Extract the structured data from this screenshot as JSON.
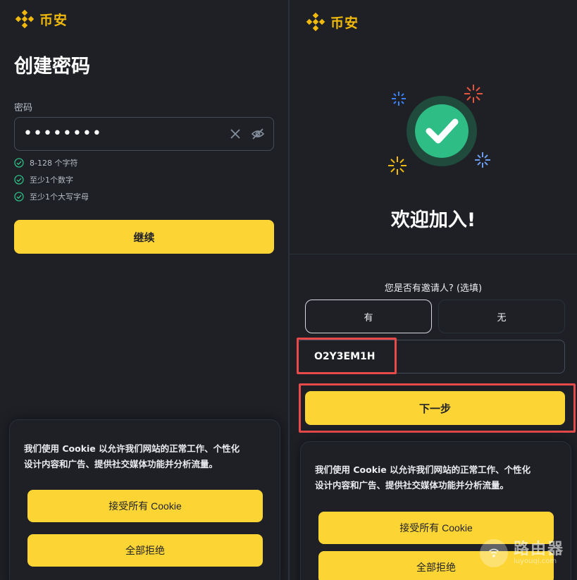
{
  "brand": {
    "name": "币安",
    "color": "#f0b90b"
  },
  "left": {
    "title": "创建密码",
    "password": {
      "label": "密码",
      "masked_value": "••••••••",
      "clear_icon": "close-icon",
      "visibility_icon": "eye-off-icon"
    },
    "rules": [
      {
        "text": "8-128 个字符",
        "status": "met"
      },
      {
        "text": "至少1个数字",
        "status": "met"
      },
      {
        "text": "至少1个大写字母",
        "status": "met"
      }
    ],
    "continue_label": "继续",
    "cookie": {
      "text_line1": "我们使用 Cookie 以允许我们网站的正常工作、个性化",
      "text_line2": "设计内容和广告、提供社交媒体功能并分析流量。",
      "accept_label": "接受所有 Cookie",
      "reject_label": "全部拒绝"
    }
  },
  "right": {
    "welcome": "欢迎加入!",
    "referral_question": "您是否有邀请人? (选填)",
    "choice_yes": "有",
    "choice_no": "无",
    "referral_code": "O2Y3EM1H",
    "next_label": "下一步",
    "cookie": {
      "text_line1": "我们使用 Cookie 以允许我们网站的正常工作、个性化",
      "text_line2": "设计内容和广告、提供社交媒体功能并分析流量。",
      "accept_label": "接受所有 Cookie",
      "reject_label": "全部拒绝"
    }
  },
  "watermark": {
    "main": "路由器",
    "sub": "luyouqi.com"
  },
  "colors": {
    "background": "#1e2026",
    "accent_yellow": "#fcd535",
    "success_green": "#2ebd85",
    "highlight_red": "#e64a4a"
  }
}
